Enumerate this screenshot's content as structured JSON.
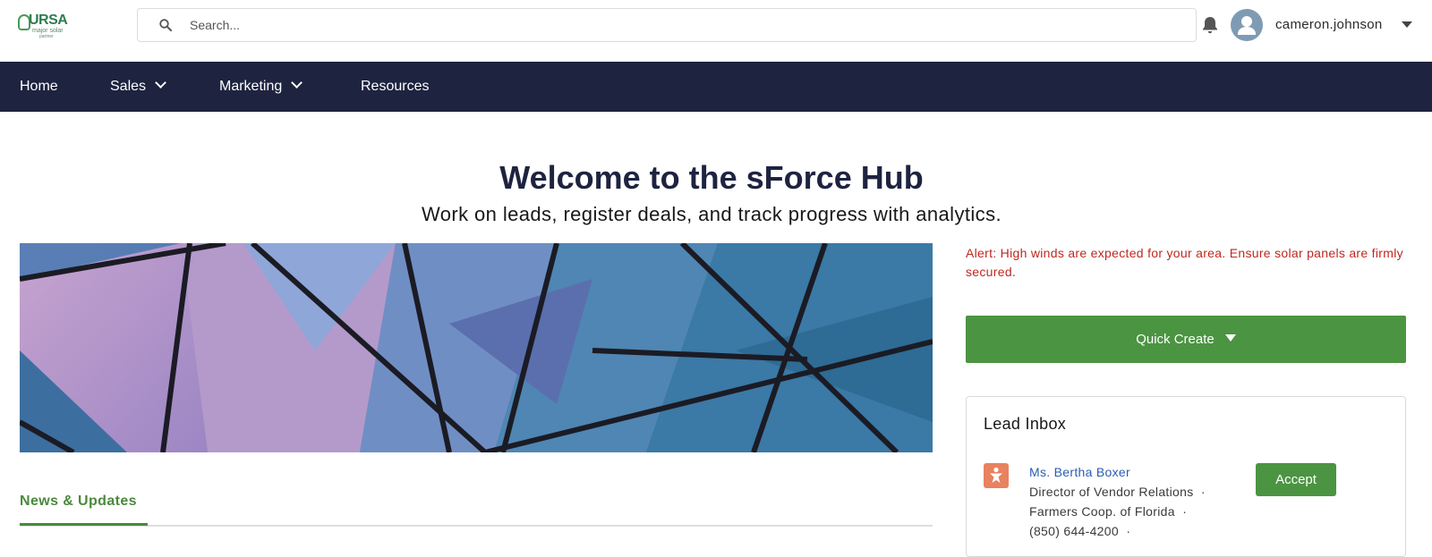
{
  "header": {
    "logo": {
      "brand": "URSA",
      "tagline": "major solar",
      "subtag": "partner"
    },
    "search": {
      "placeholder": "Search...",
      "value": ""
    },
    "user": {
      "name": "cameron.johnson"
    }
  },
  "nav": {
    "items": [
      {
        "label": "Home",
        "has_dropdown": false
      },
      {
        "label": "Sales",
        "has_dropdown": true
      },
      {
        "label": "Marketing",
        "has_dropdown": true
      },
      {
        "label": "Resources",
        "has_dropdown": false
      }
    ]
  },
  "hero": {
    "title": "Welcome to the sForce Hub",
    "subtitle": "Work on leads, register deals, and track progress with analytics."
  },
  "news": {
    "tab_label": "News & Updates"
  },
  "sidebar": {
    "alert": "Alert: High winds are expected for your area. Ensure solar panels are firmly secured.",
    "quick_create_label": "Quick Create",
    "lead_inbox": {
      "title": "Lead Inbox",
      "leads": [
        {
          "name": "Ms. Bertha Boxer",
          "title": "Director of Vendor Relations",
          "company": "Farmers Coop. of Florida",
          "phone": "(850) 644-4200",
          "action_label": "Accept"
        }
      ]
    }
  },
  "colors": {
    "nav_bg": "#1e2340",
    "primary_green": "#4b9441",
    "alert_red": "#c0271f",
    "link_blue": "#2a5db0",
    "lead_icon": "#e8825f"
  }
}
